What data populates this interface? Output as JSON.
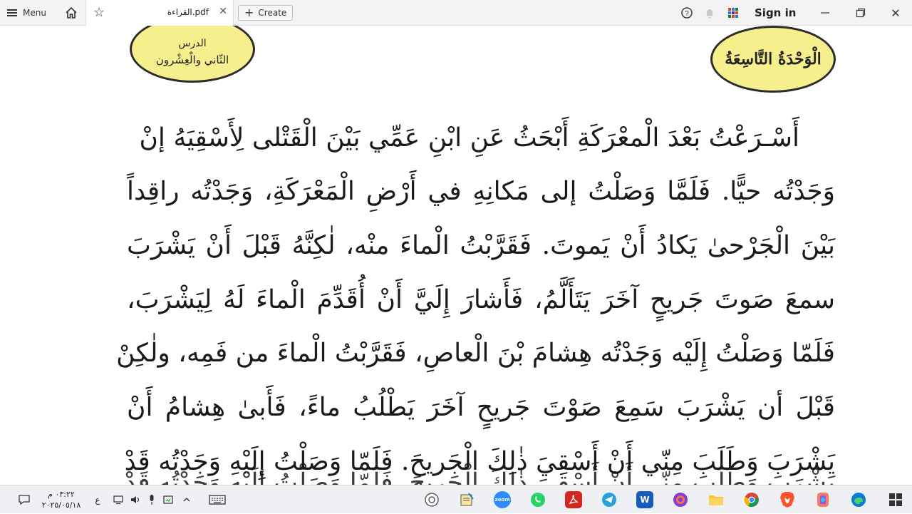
{
  "topbar": {
    "menu_label": "Menu",
    "tab_title": "القراءة.pdf",
    "create_label": "Create",
    "signin_label": "Sign in"
  },
  "document": {
    "badge_lesson_line1": "الدرس",
    "badge_lesson_line2": "الثّاني والْعِشْرون",
    "badge_unit": "الْوَحْدَةُ التَّاسِعَةُ",
    "lines": [
      "أَسْـرَعْتُ بَعْدَ الْمعْرَكَةِ أَبْحَثُ عَنِ ابْنِ عَمِّي بَيْنَ الْقَتْلى لِأَسْقِيَهُ إنْ",
      "وَجَدْتُه حيًّا. فَلَمَّا وَصَلْتُ إلى مَكانِهِ في أَرْضِ الْمَعْرَكَةِ، وَجَدْتُه راقِداً",
      "بَيْنَ الْجَرْحىٰ يَكادُ أَنْ يَموتَ. فَقَرَّبْتُ الْماءَ منْه، لٰكِنَّهُ قَبْلَ أَنْ يَشْرَبَ",
      "سمعَ صَوتَ جَريحٍ آخَرَ يَتَأَلَّمُ، فَأَشارَ إِلَيَّ أَنْ أُقَدِّمَ الْماءَ لَهُ لِيَشْرَبَ،",
      "فَلَمّا وَصَلْتُ إِلَيْه وَجَدْتُه هِشامَ بْنَ الْعاصِ، فَقَرَّبْتُ الْماءَ من فَمِه، ولٰكِنْ",
      "قَبْلَ أن يَشْرَبَ سَمِعَ صَوْتَ جَريحٍ آخَرَ يَطْلُبُ ماءً، فَأَبىٰ هِشامُ أَنْ",
      "يَشْرَبَ وَطَلَبَ مِنّي أَنْ أَسْقِيَ ذٰلِكَ الْجَريحَ. فَلَمّا وَصَلْتُ إِلَيْهِ وَجَدْتُه قَدْ",
      "يَشْرَبَ وَطَلَبَ مِنّي أَنْ أَسْقِيَ ذٰلِكَ الْجَريحَ. فَلَمّا وَصَلْتُ إِلَيْهِ وَجَدْتُه قَدْ"
    ]
  },
  "taskbar": {
    "time": "٠٣:٢٢ م",
    "date": "٢٠٢٥/٠٥/١٨",
    "lang": "ع",
    "zoom_label": "zoom",
    "word_label": "W"
  },
  "colors": {
    "badge_fill": "#f5ef8e",
    "topbar_bg": "#f3f3f3",
    "taskbar_bg": "#eef0f3",
    "acrobat_red": "#d4271f",
    "zoom_blue": "#2d8cff",
    "whatsapp_green": "#25d366",
    "telegram_blue": "#2aa1da",
    "word_blue": "#185abd",
    "brave_orange": "#fb542b"
  }
}
